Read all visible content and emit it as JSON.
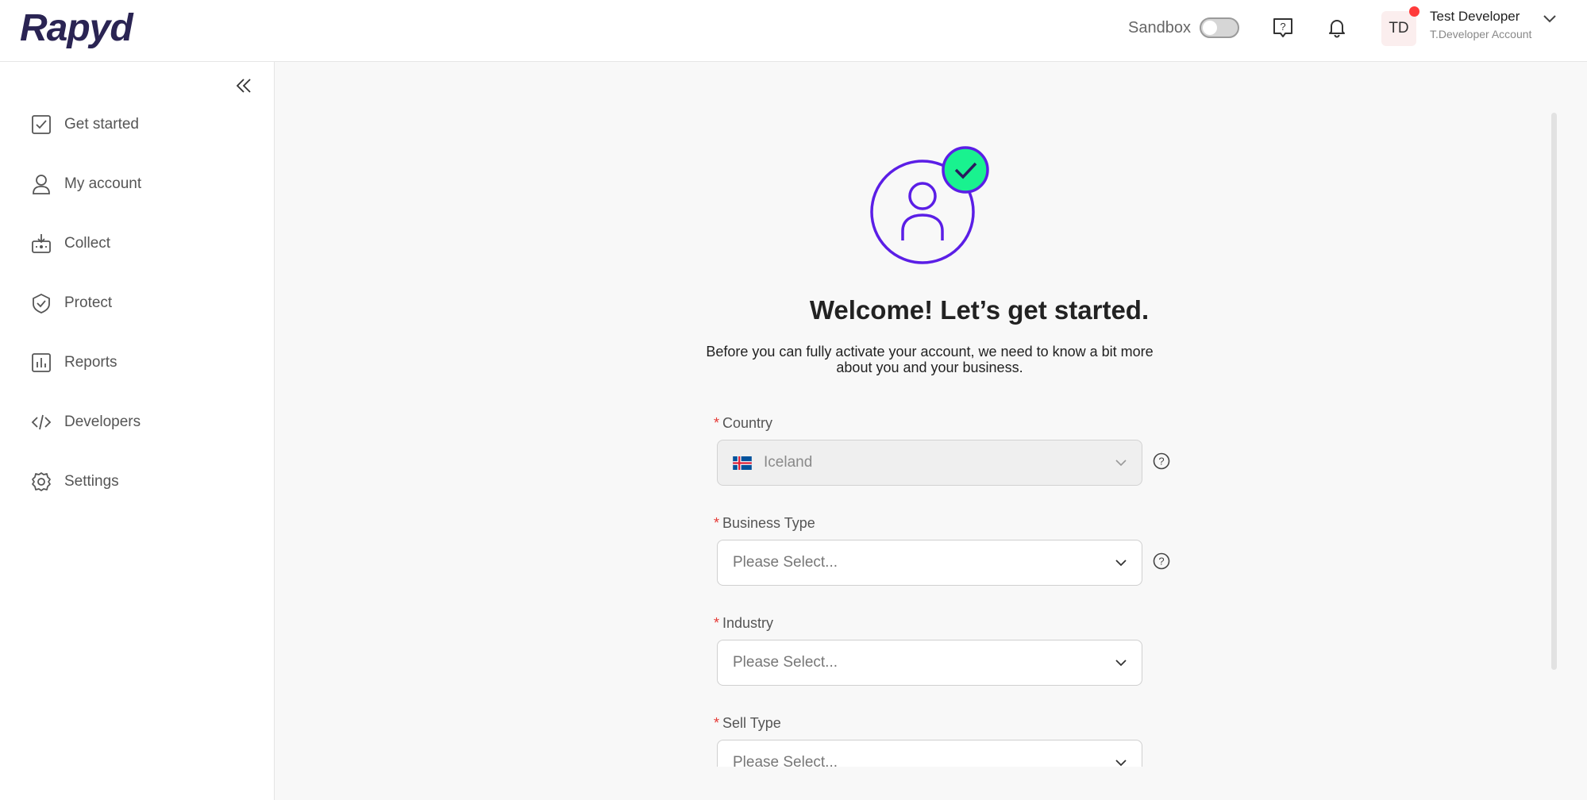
{
  "header": {
    "logo": "Rapyd",
    "sandbox_label": "Sandbox",
    "user": {
      "initials": "TD",
      "name": "Test Developer",
      "account": "T.Developer Account"
    }
  },
  "sidebar": {
    "items": [
      {
        "label": "Get started",
        "icon": "checkbox-icon"
      },
      {
        "label": "My account",
        "icon": "user-icon"
      },
      {
        "label": "Collect",
        "icon": "collect-icon"
      },
      {
        "label": "Protect",
        "icon": "shield-icon"
      },
      {
        "label": "Reports",
        "icon": "bar-chart-icon"
      },
      {
        "label": "Developers",
        "icon": "code-icon"
      },
      {
        "label": "Settings",
        "icon": "gear-icon"
      }
    ]
  },
  "main": {
    "title": "Welcome! Let’s get started.",
    "subtitle": "Before you can fully activate your account, we need to know a bit more about you and your business.",
    "form": {
      "country": {
        "label": "Country",
        "value": "Iceland"
      },
      "business_type": {
        "label": "Business Type",
        "placeholder": "Please Select..."
      },
      "industry": {
        "label": "Industry",
        "placeholder": "Please Select..."
      },
      "sell_type": {
        "label": "Sell Type",
        "placeholder": "Please Select..."
      }
    }
  },
  "colors": {
    "brand": "#2a2453",
    "accent": "#5b1ee6",
    "success": "#19f28f",
    "required": "#e53935"
  }
}
